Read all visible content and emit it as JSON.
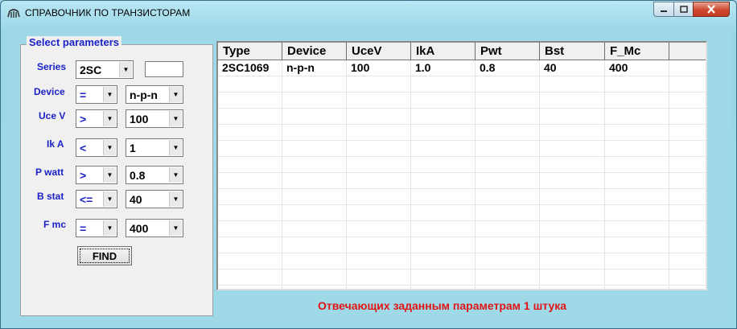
{
  "window": {
    "title": "СПРАВОЧНИК ПО ТРАНЗИСТОРАМ",
    "icon": "transistor-app-icon"
  },
  "params": {
    "legend": "Select parameters",
    "series": {
      "label": "Series",
      "value": "2SC",
      "extra": ""
    },
    "device": {
      "label": "Device",
      "op": "=",
      "value": "n-p-n"
    },
    "uce": {
      "label": "Uce V",
      "op": ">",
      "value": "100"
    },
    "ik": {
      "label": "Ik A",
      "op": "<",
      "value": "1"
    },
    "pwatt": {
      "label": "P watt",
      "op": ">",
      "value": "0.8"
    },
    "bstat": {
      "label": "B stat",
      "op": "<=",
      "value": "40"
    },
    "fmc": {
      "label": "F mc",
      "op": "=",
      "value": "400"
    },
    "find_label": "FIND"
  },
  "table": {
    "columns": [
      "Type",
      "Device",
      "UceV",
      "IkA",
      "Pwt",
      "Bst",
      "F_Mc"
    ],
    "rows": [
      [
        "2SC1069",
        "n-p-n",
        "100",
        "1.0",
        "0.8",
        "40",
        "400"
      ]
    ]
  },
  "status": "Отвечающих заданным параметрам  1 штука",
  "colors": {
    "background": "#9fd9e8",
    "label_blue": "#1a22c8",
    "status_red": "#e01414"
  }
}
